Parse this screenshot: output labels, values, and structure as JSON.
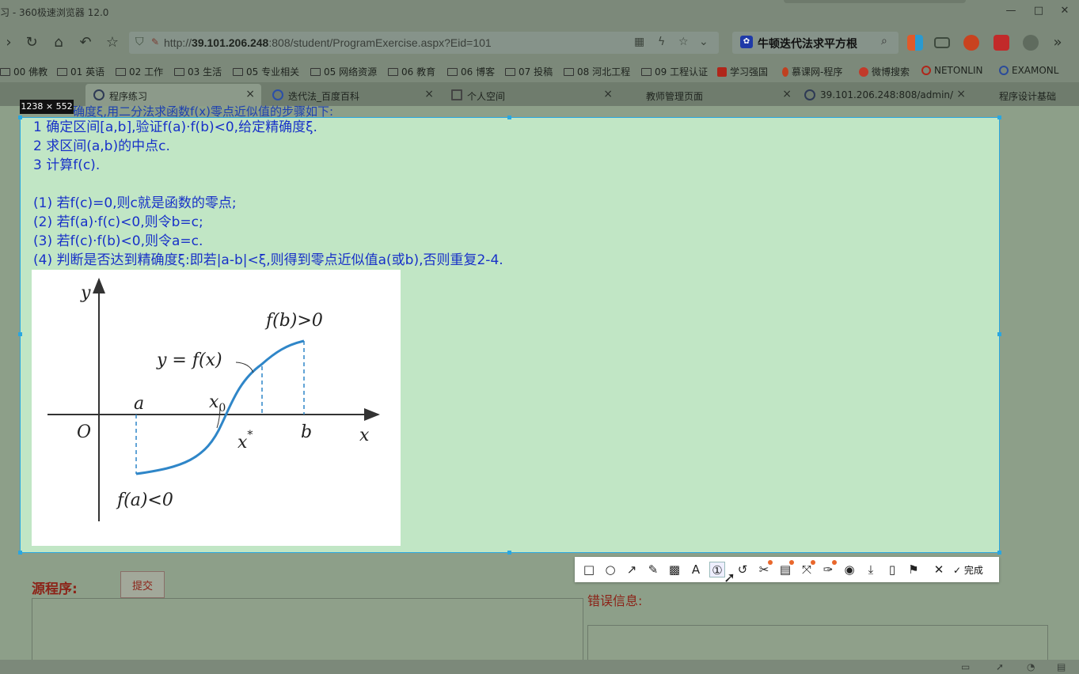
{
  "window": {
    "title": "习 - 360极速浏览器 12.0"
  },
  "navbar": {
    "url_prefix": "http://",
    "url_host": "39.101.206.248",
    "url_rest": ":808/student/ProgramExercise.aspx?Eid=101",
    "search_query": "牛顿迭代法求平方根"
  },
  "bookmarks": [
    {
      "label": "00 佛教"
    },
    {
      "label": "01 英语"
    },
    {
      "label": "02 工作"
    },
    {
      "label": "03 生活"
    },
    {
      "label": "05 专业相关"
    },
    {
      "label": "05 网络资源"
    },
    {
      "label": "06 教育"
    },
    {
      "label": "06 博客"
    },
    {
      "label": "07 投稿"
    },
    {
      "label": "08 河北工程"
    },
    {
      "label": "09 工程认证"
    },
    {
      "label": "学习强国",
      "color": "#b0261a"
    },
    {
      "label": "慕课网-程序",
      "color": "#c04020"
    },
    {
      "label": "微博搜索",
      "color": "#c23a2a"
    },
    {
      "label": "NETONLIN",
      "color": "#b0261a"
    },
    {
      "label": "EXAMONL",
      "color": "#2b4b9a"
    }
  ],
  "tabs": [
    {
      "label": "程序练习",
      "active": true
    },
    {
      "label": "迭代法_百度百科"
    },
    {
      "label": "个人空间"
    },
    {
      "label": "教师管理页面"
    },
    {
      "label": "39.101.206.248:808/admin/"
    },
    {
      "label": "程序设计基础"
    }
  ],
  "selection": {
    "size_label": "1238 × 552",
    "cut_text": "确度ξ,用二分法求函数f(x)零点近似值的步骤如下:",
    "steps": [
      "1 确定区间[a,b],验证f(a)·f(b)<0,给定精确度ξ.",
      "2 求区间(a,b)的中点c.",
      "3 计算f(c).",
      "",
      "(1) 若f(c)=0,则c就是函数的零点;",
      "(2) 若f(a)·f(c)<0,则令b=c;",
      "(3) 若f(c)·f(b)<0,则令a=c.",
      "(4) 判断是否达到精确度ξ:即若|a-b|<ξ,则得到零点近似值a(或b),否则重复2-4."
    ],
    "figure": {
      "y_axis": "y",
      "x_axis": "x",
      "origin": "O",
      "label_a": "a",
      "label_b": "b",
      "label_x0": "x",
      "label_x0_sub": "0",
      "label_xstar": "x",
      "label_xstar_sup": "*",
      "curve_label": "y = f(x)",
      "fb_label": "f(b)>0",
      "fa_label": "f(a)<0",
      "curve_color": "#2f86c8"
    }
  },
  "page": {
    "source_label": "源程序:",
    "submit_label": "提交",
    "error_label": "错误信息:"
  },
  "toolbar": {
    "done_label": "完成",
    "tools": [
      "rect-icon",
      "ellipse-icon",
      "arrow-icon",
      "pen-icon",
      "mosaic-icon",
      "text-icon",
      "number-icon",
      "undo-icon",
      "scissors-icon",
      "ocr-icon",
      "expand-icon",
      "pin-icon",
      "record-icon",
      "download-icon",
      "phone-icon",
      "bookmark-icon"
    ]
  }
}
